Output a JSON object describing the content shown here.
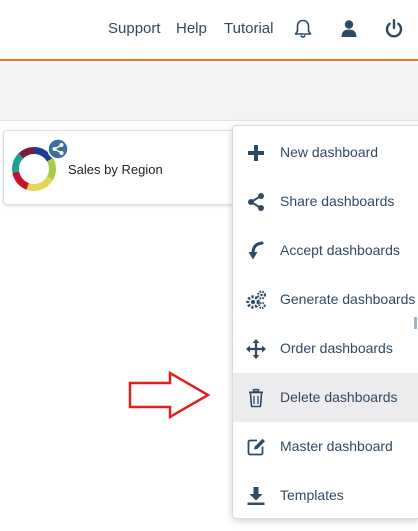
{
  "topnav": {
    "support": "Support",
    "help": "Help",
    "tutorial": "Tutorial",
    "icons": [
      "bell-icon",
      "user-icon",
      "power-icon"
    ]
  },
  "dashboard_card": {
    "title": "Sales by Region",
    "icons": [
      "donut-chart-icon",
      "share-icon"
    ]
  },
  "menu": {
    "items": [
      {
        "label": "New dashboard",
        "icon": "plus-icon"
      },
      {
        "label": "Share dashboards",
        "icon": "share-icon"
      },
      {
        "label": "Accept dashboards",
        "icon": "curved-arrow-down-icon"
      },
      {
        "label": "Generate dashboards",
        "icon": "gears-icon"
      },
      {
        "label": "Order dashboards",
        "icon": "move-arrows-icon"
      },
      {
        "label": "Delete dashboards",
        "icon": "trash-icon",
        "highlighted": true
      },
      {
        "label": "Master dashboard",
        "icon": "edit-icon"
      },
      {
        "label": "Templates",
        "icon": "download-icon"
      }
    ]
  },
  "colors": {
    "accent_orange": "#e8722c",
    "text_navy": "#2f4a63",
    "annotation_red": "#e02020",
    "highlight_bg": "#ececef"
  }
}
